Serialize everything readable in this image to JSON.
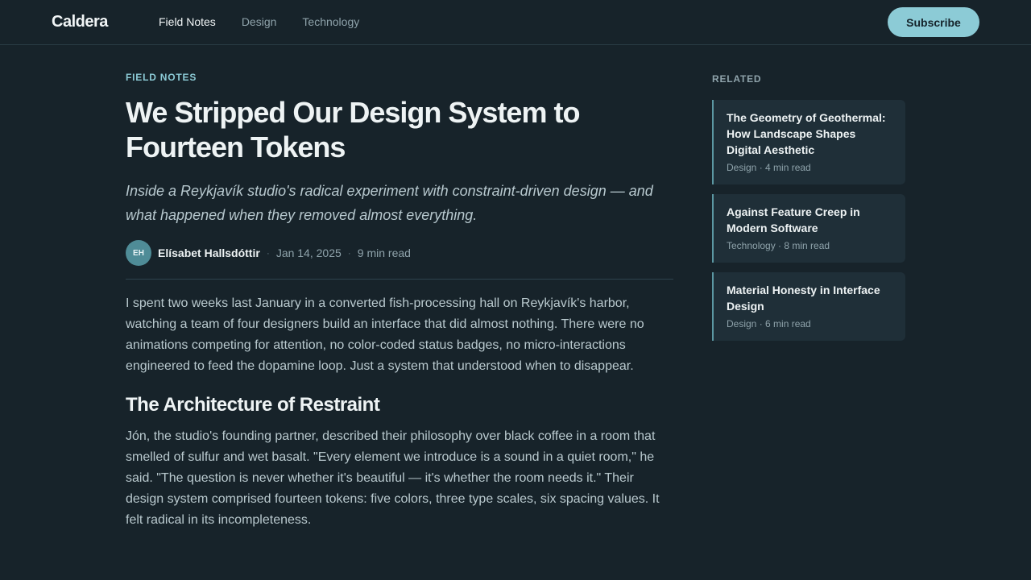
{
  "header": {
    "logo": "Caldera",
    "nav": [
      {
        "label": "Field Notes",
        "active": true
      },
      {
        "label": "Design",
        "active": false
      },
      {
        "label": "Technology",
        "active": false
      }
    ],
    "subscribe_label": "Subscribe"
  },
  "article": {
    "category": "Field Notes",
    "title": "We Stripped Our Design System to Fourteen Tokens",
    "subtitle": "Inside a Reykjavík studio's radical experiment with constraint-driven design — and what happened when they removed almost everything.",
    "author": {
      "initials": "EH",
      "name": "Elísabet Hallsdóttir"
    },
    "date": "Jan 14, 2025",
    "read_time": "9 min read",
    "separator": "·",
    "paragraph_1": "I spent two weeks last January in a converted fish-processing hall on Reykjavík's harbor, watching a team of four designers build an interface that did almost nothing. There were no animations competing for attention, no color-coded status badges, no micro-interactions engineered to feed the dopamine loop. Just a system that understood when to disappear.",
    "section_heading": "The Architecture of Restraint",
    "paragraph_2": "Jón, the studio's founding partner, described their philosophy over black coffee in a room that smelled of sulfur and wet basalt. \"Every element we introduce is a sound in a quiet room,\" he said. \"The question is never whether it's beautiful — it's whether the room needs it.\" Their design system comprised fourteen tokens: five colors, three type scales, six spacing values. It felt radical in its incompleteness."
  },
  "sidebar": {
    "label": "Related",
    "items": [
      {
        "title": "The Geometry of Geothermal: How Landscape Shapes Digital Aesthetic",
        "meta": "Design · 4 min read"
      },
      {
        "title": "Against Feature Creep in Modern Software",
        "meta": "Technology · 8 min read"
      },
      {
        "title": "Material Honesty in Interface Design",
        "meta": "Design · 6 min read"
      }
    ]
  },
  "colors": {
    "background": "#17232a",
    "accent": "#8ccbd6",
    "card": "#1f2f38",
    "card_border": "#5b97a2"
  }
}
